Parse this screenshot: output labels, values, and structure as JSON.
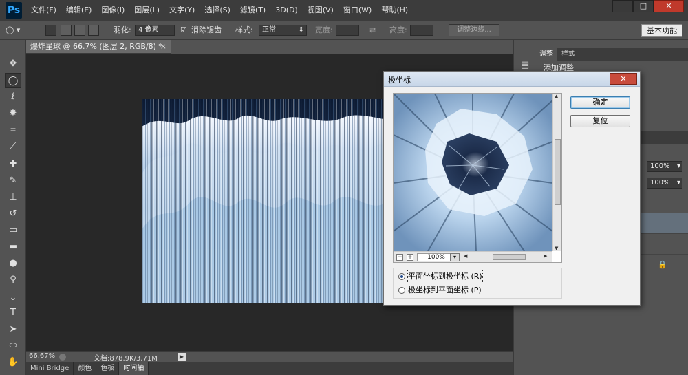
{
  "app": {
    "logo": "Ps"
  },
  "menu": [
    "文件(F)",
    "编辑(E)",
    "图像(I)",
    "图层(L)",
    "文字(Y)",
    "选择(S)",
    "滤镜(T)",
    "3D(D)",
    "视图(V)",
    "窗口(W)",
    "帮助(H)"
  ],
  "window_controls": {
    "minimize": "−",
    "maximize": "□",
    "close": "✕"
  },
  "options": {
    "feather_label": "羽化:",
    "feather_value": "4 像素",
    "antialias_label": "消除锯齿",
    "antialias_checked": true,
    "style_label": "样式:",
    "style_value": "正常",
    "width_label": "宽度:",
    "height_label": "高度:",
    "refine_edge": "调整边缘...",
    "workspace": "基本功能"
  },
  "document": {
    "tab_title": "爆炸星球 @ 66.7% (图层 2, RGB/8) *",
    "tab_close": "×"
  },
  "status": {
    "zoom": "66.67%",
    "doc_info": "文档:878.9K/3.71M"
  },
  "bottom_tabs": [
    "Mini Bridge",
    "颜色",
    "色板",
    "时间轴"
  ],
  "bottom_tabs_active": 3,
  "right_panel": {
    "tabs": [
      "调整",
      "样式"
    ],
    "add_adjustment": "添加调整",
    "opacity": "100%",
    "fill": "100%"
  },
  "dialog": {
    "title": "极坐标",
    "close": "✕",
    "ok": "确定",
    "reset": "复位",
    "zoom": "100%",
    "zoom_minus": "−",
    "zoom_plus": "+",
    "options": [
      {
        "label": "平面坐标到极坐标 (R)",
        "checked": true
      },
      {
        "label": "极坐标到平面坐标 (P)",
        "checked": false
      }
    ]
  },
  "colors": {
    "ps_background": "#535353",
    "canvas_background": "#282828",
    "dialog_background": "#f0f0f0",
    "accent": "#31a8ff"
  }
}
